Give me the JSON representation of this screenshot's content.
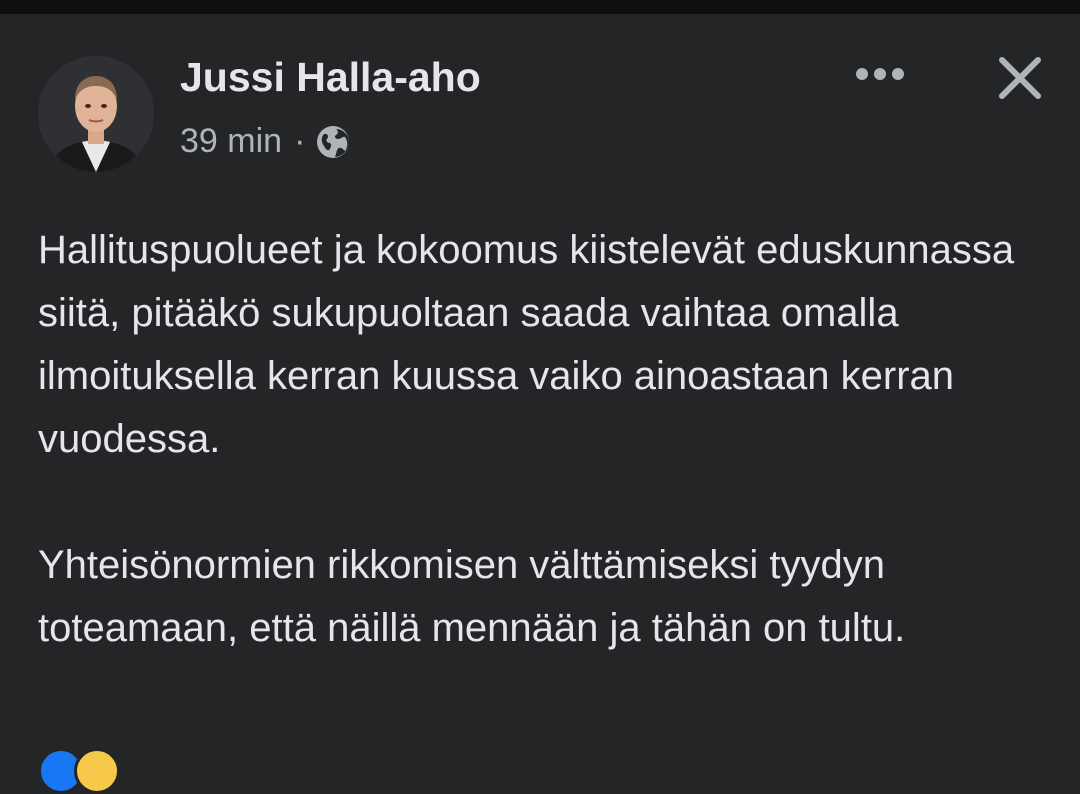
{
  "post": {
    "author": "Jussi Halla-aho",
    "timestamp": "39 min",
    "separator": "·",
    "privacy_icon": "globe-icon",
    "more_icon": "more-horizontal-icon",
    "close_icon": "close-icon",
    "paragraphs": [
      "Hallituspuolueet ja kokoomus kiistelevät eduskunnassa siitä, pitääkö sukupuoltaan saada vaihtaa omalla ilmoituksella kerran kuussa vaiko ainoastaan kerran vuodessa.",
      "Yhteisönormien rikkomisen välttämiseksi tyydyn toteamaan, että näillä mennään ja tähän on tultu."
    ],
    "reactions": [
      "like",
      "haha"
    ]
  },
  "colors": {
    "background": "#242526",
    "text_primary": "#e4e6eb",
    "text_secondary": "#b0b3b8",
    "top_bar": "#0f0f10",
    "like_blue": "#1877f2",
    "haha_yellow": "#f7c94a"
  }
}
